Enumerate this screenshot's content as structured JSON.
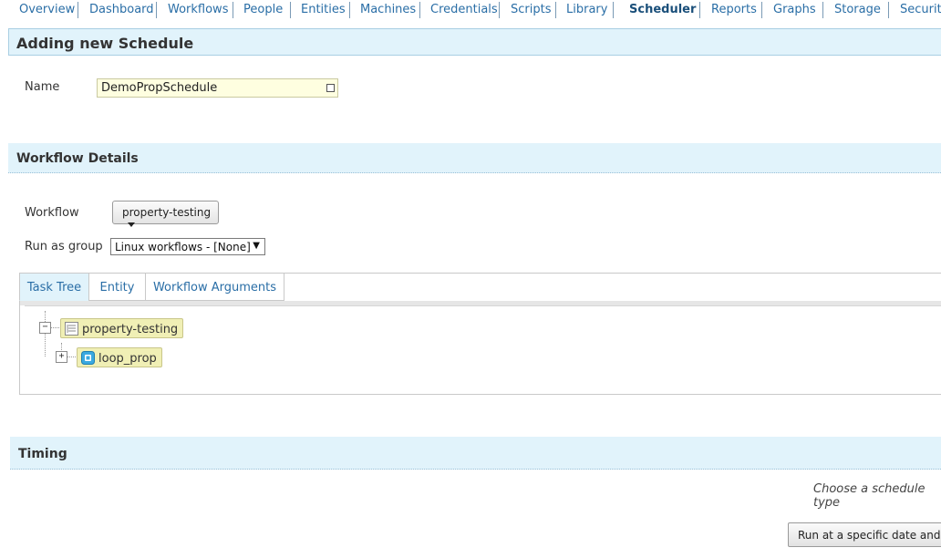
{
  "nav": {
    "items": [
      "Overview",
      "Dashboard",
      "Workflows",
      "People",
      "Entities",
      "Machines",
      "Credentials",
      "Scripts",
      "Library",
      "Scheduler",
      "Reports",
      "Graphs",
      "Storage",
      "Security"
    ],
    "active": "Scheduler"
  },
  "page": {
    "title": "Adding new Schedule"
  },
  "name_field": {
    "label": "Name",
    "value": "DemoPropSchedule"
  },
  "workflow_section": {
    "title": "Workflow Details",
    "workflow_label": "Workflow",
    "workflow_value": "property-testing",
    "run_as_label": "Run as group",
    "run_as_value": "Linux workflows - [None]"
  },
  "tabs": [
    "Task Tree",
    "Entity",
    "Workflow Arguments"
  ],
  "tree": {
    "root": {
      "toggle": "−",
      "label": "property-testing"
    },
    "child": {
      "toggle": "+",
      "label": "loop_prop"
    }
  },
  "timing": {
    "title": "Timing",
    "choose_text": "Choose a schedule type",
    "run_button": "Run at a specific date and time"
  },
  "colors": {
    "header_bg": "#e1f3fb",
    "link": "#2a6ea6",
    "node_bg": "#f0efb5",
    "input_bg": "#fefee0"
  }
}
